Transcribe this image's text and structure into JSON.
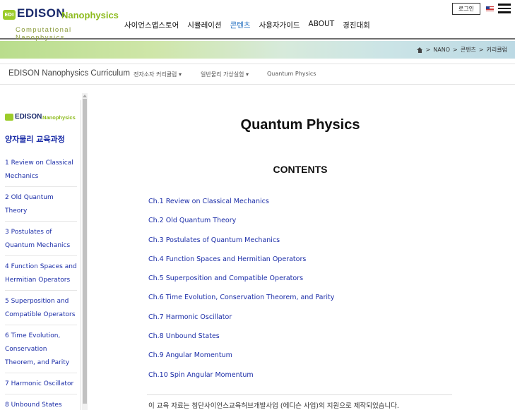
{
  "header": {
    "logo": {
      "mark": "EDI",
      "brand": "EDISON",
      "suffix": "Nanophysics",
      "tagline": "Computational Nanophysics"
    },
    "nav": [
      "사이언스앱스토어",
      "시뮬레이션",
      "콘텐츠",
      "사용자가이드",
      "ABOUT",
      "경진대회"
    ],
    "active_nav": "콘텐츠",
    "login_label": "로그인",
    "flag_icon": "us-flag-icon",
    "menu_icon": "hamburger-menu-icon"
  },
  "breadcrumb": {
    "home_icon": "home-icon",
    "items": [
      "NANO",
      "콘텐츠",
      "커리큘럼"
    ],
    "separators": [
      ">",
      ">",
      ">"
    ]
  },
  "subnav": {
    "title": "EDISON Nanophysics Curriculum",
    "items": [
      "전자소자 커리큘럼 ▾",
      "일반물리 가상실험 ▾",
      "Quantum Physics"
    ]
  },
  "sidebar": {
    "logo": {
      "brand": "EDISON",
      "suffix": ".Nanophysics"
    },
    "title": "양자물리 교육과정",
    "items": [
      "1 Review on Classical Mechanics",
      "2 Old Quantum Theory",
      "3 Postulates of Quantum Mechanics",
      "4 Function Spaces and Hermitian Operators",
      "5 Superposition and Compatible Operators",
      "6 Time Evolution, Conservation Theorem, and Parity",
      "7 Harmonic Oscillator",
      "8 Unbound States"
    ]
  },
  "main": {
    "title": "Quantum Physics",
    "contents_heading": "CONTENTS",
    "chapters": [
      "Ch.1 Review on Classical Mechanics",
      "Ch.2 Old Quantum Theory",
      "Ch.3 Postulates of Quantum Mechanics",
      "Ch.4 Function Spaces and Hermitian Operators",
      "Ch.5 Superposition and Compatible Operators",
      "Ch.6 Time Evolution, Conservation Theorem, and Parity",
      "Ch.7 Harmonic Oscillator",
      "Ch.8 Unbound States",
      "Ch.9 Angular Momentum",
      "Ch.10 Spin Angular Momentum"
    ],
    "footer_note": "이 교육 자료는 첨단사이언스교육허브개발사업 (에디슨 사업)의 지원으로 제작되었습니다."
  },
  "colors": {
    "link": "#1c2ea8",
    "active_nav": "#1c6bbf",
    "brand_green": "#8dbb1d",
    "brand_navy": "#1a2a6c"
  }
}
